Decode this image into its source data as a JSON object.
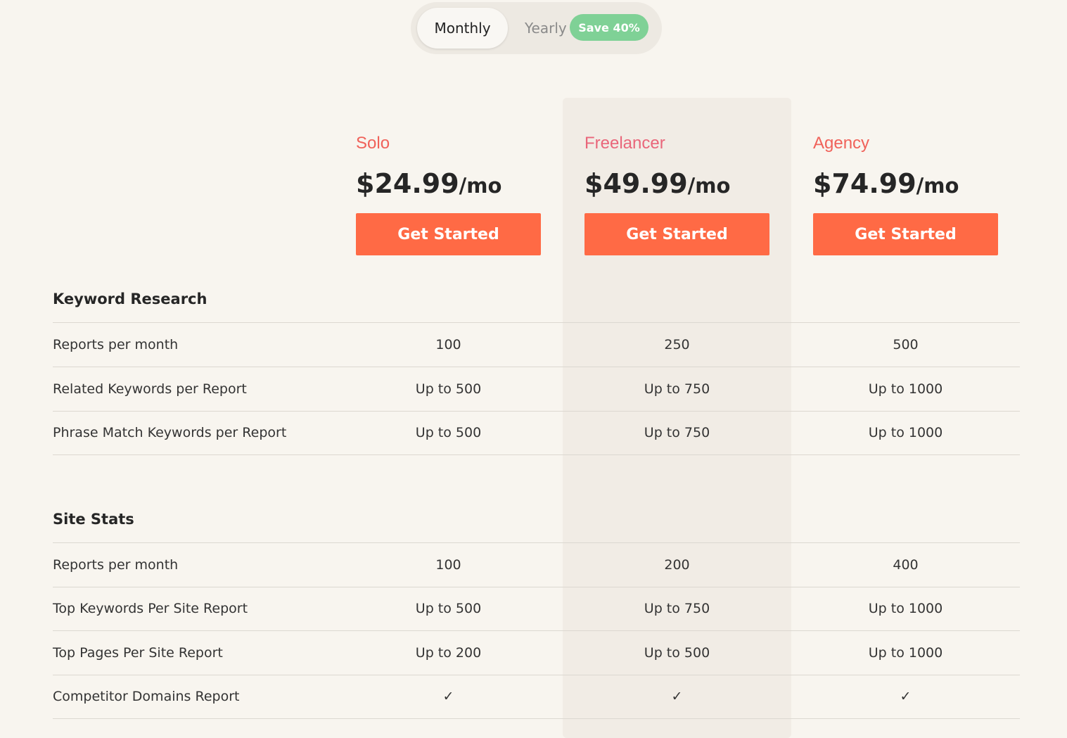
{
  "billing_toggle": {
    "monthly_label": "Monthly",
    "yearly_label": "Yearly",
    "save_badge": "Save 40%",
    "selected": "Monthly"
  },
  "plans": [
    {
      "name": "Solo",
      "price": "$24.99",
      "per": "/mo",
      "cta": "Get Started",
      "name_color": "#f0625a"
    },
    {
      "name": "Freelancer",
      "price": "$49.99",
      "per": "/mo",
      "cta": "Get Started",
      "name_color": "#e9667a"
    },
    {
      "name": "Agency",
      "price": "$74.99",
      "per": "/mo",
      "cta": "Get Started",
      "name_color": "#f0625a"
    }
  ],
  "sections": [
    {
      "title": "Keyword Research",
      "rows": [
        {
          "label": "Reports per month",
          "values": [
            "100",
            "250",
            "500"
          ]
        },
        {
          "label": "Related Keywords per Report",
          "values": [
            "Up to 500",
            "Up to 750",
            "Up to 1000"
          ]
        },
        {
          "label": "Phrase Match Keywords per Report",
          "values": [
            "Up to 500",
            "Up to 750",
            "Up to 1000"
          ]
        }
      ]
    },
    {
      "title": "Site Stats",
      "rows": [
        {
          "label": "Reports per month",
          "values": [
            "100",
            "200",
            "400"
          ]
        },
        {
          "label": "Top Keywords Per Site Report",
          "values": [
            "Up to 500",
            "Up to 750",
            "Up to 1000"
          ]
        },
        {
          "label": "Top Pages Per Site Report",
          "values": [
            "Up to 200",
            "Up to 500",
            "Up to 1000"
          ]
        },
        {
          "label": "Competitor Domains Report",
          "values": [
            "✓",
            "✓",
            "✓"
          ]
        }
      ]
    }
  ],
  "colors": {
    "accent": "#ff6a45",
    "badge": "#7fd196",
    "background": "#f8f5ef",
    "highlight_column": "#f1ece5"
  }
}
